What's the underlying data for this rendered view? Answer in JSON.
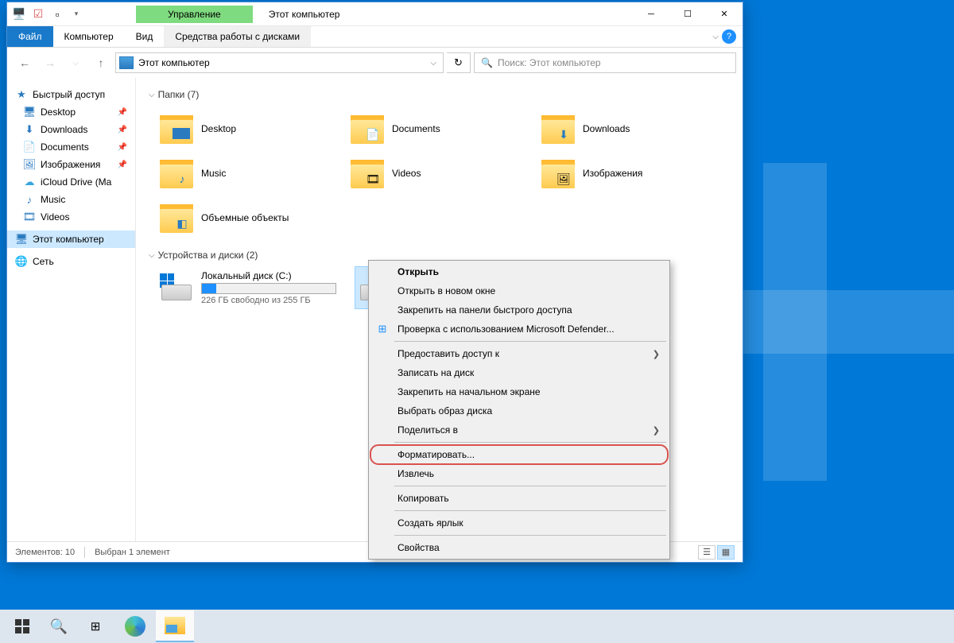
{
  "window": {
    "manage_tab": "Управление",
    "title": "Этот компьютер",
    "ribbon": {
      "file": "Файл",
      "computer": "Компьютер",
      "view": "Вид",
      "tools": "Средства работы с дисками"
    }
  },
  "address": {
    "path": "Этот компьютер",
    "search_placeholder": "Поиск: Этот компьютер"
  },
  "sidebar": {
    "quick_access": "Быстрый доступ",
    "items": [
      {
        "label": "Desktop"
      },
      {
        "label": "Downloads"
      },
      {
        "label": "Documents"
      },
      {
        "label": "Изображения"
      },
      {
        "label": "iCloud Drive (Ma"
      },
      {
        "label": "Music"
      },
      {
        "label": "Videos"
      }
    ],
    "this_pc": "Этот компьютер",
    "network": "Сеть"
  },
  "content": {
    "folders_header": "Папки (7)",
    "folders": [
      {
        "label": "Desktop"
      },
      {
        "label": "Documents"
      },
      {
        "label": "Downloads"
      },
      {
        "label": "Music"
      },
      {
        "label": "Videos"
      },
      {
        "label": "Изображения"
      },
      {
        "label": "Объемные объекты"
      }
    ],
    "drives_header": "Устройства и диски (2)",
    "drive_c": {
      "name": "Локальный диск (C:)",
      "free": "226 ГБ свободно из 255 ГБ",
      "fill_pct": 11
    }
  },
  "statusbar": {
    "items": "Элементов: 10",
    "selected": "Выбран 1 элемент"
  },
  "context_menu": {
    "open": "Открыть",
    "open_new": "Открыть в новом окне",
    "pin_quick": "Закрепить на панели быстрого доступа",
    "defender": "Проверка с использованием Microsoft Defender...",
    "give_access": "Предоставить доступ к",
    "burn": "Записать на диск",
    "pin_start": "Закрепить на начальном экране",
    "select_image": "Выбрать образ диска",
    "share": "Поделиться в",
    "format": "Форматировать...",
    "eject": "Извлечь",
    "copy": "Копировать",
    "shortcut": "Создать ярлык",
    "properties": "Свойства"
  }
}
